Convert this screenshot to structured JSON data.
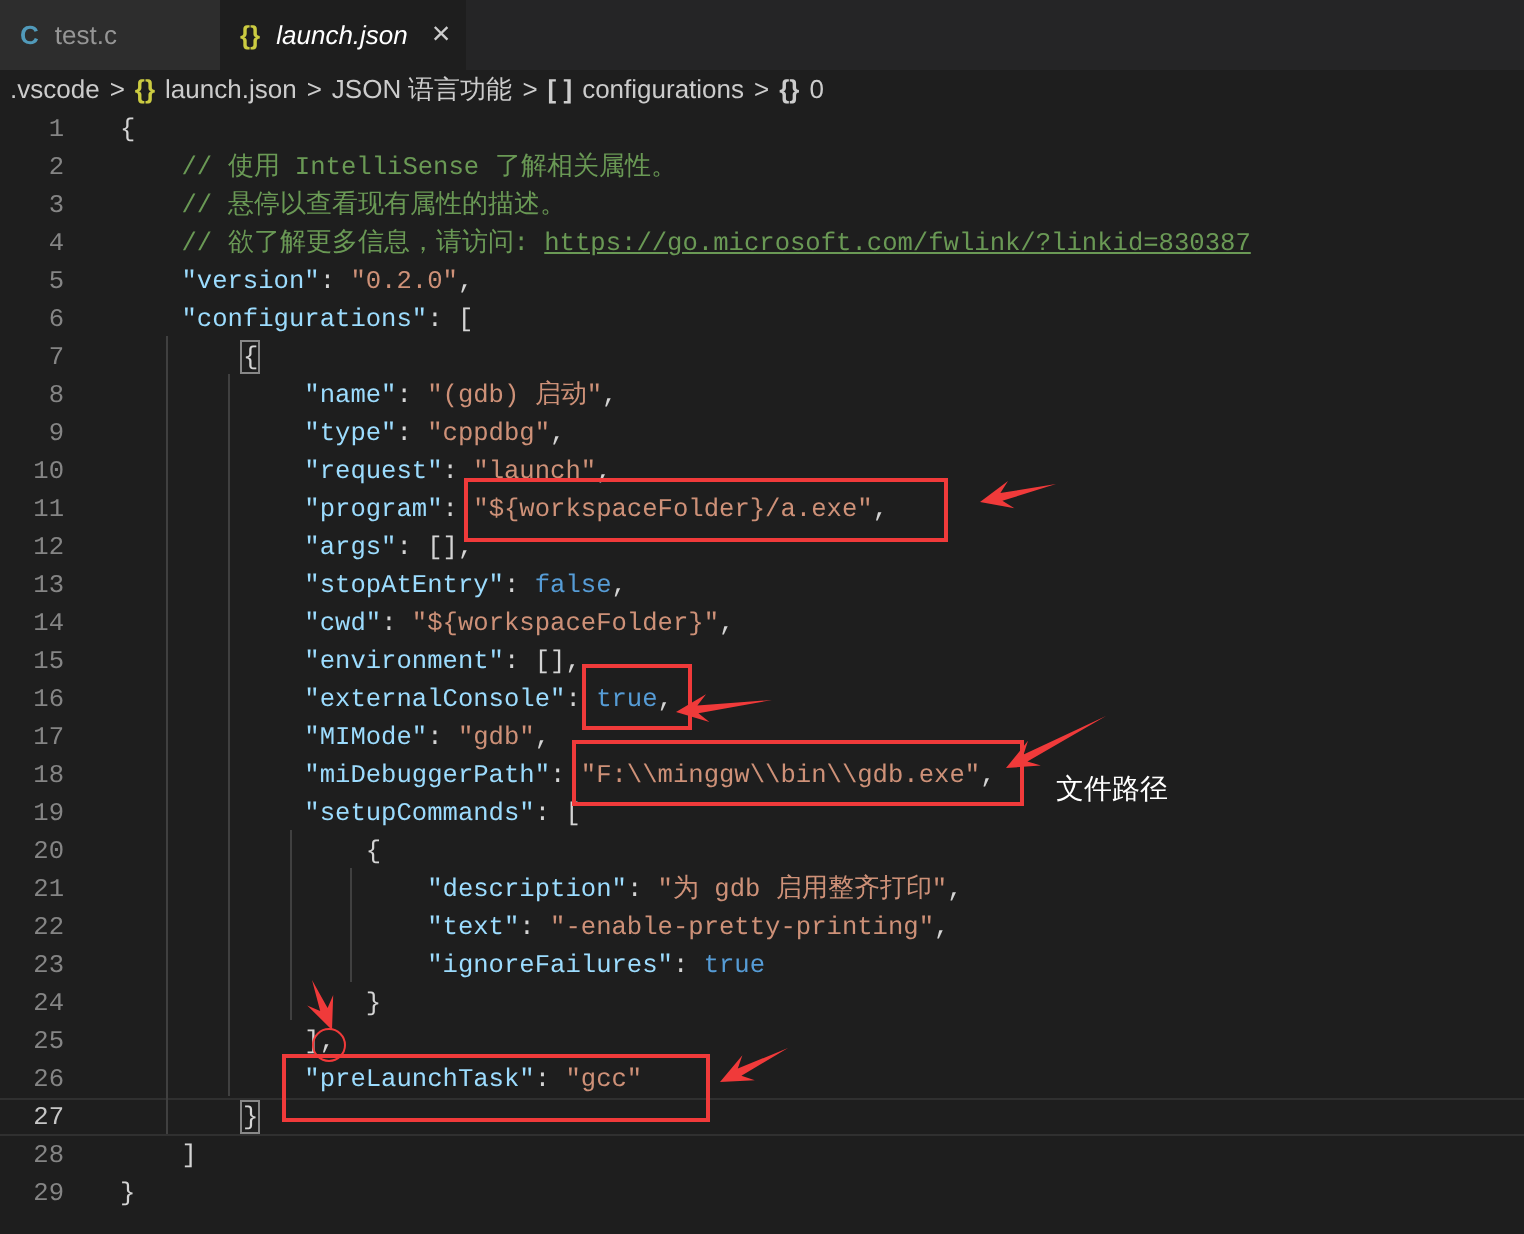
{
  "tabs": [
    {
      "icon": "C",
      "color": "#519aba",
      "label": "test.c",
      "selected": false,
      "preview": false
    },
    {
      "icon": "{}",
      "color": "#cbcb41",
      "label": "launch.json",
      "selected": true,
      "preview": true,
      "close": "×"
    }
  ],
  "breadcrumbs": [
    {
      "label": ".vscode"
    },
    {
      "separator": ">"
    },
    {
      "icon": "{}",
      "color": "#cbcb41",
      "label": "launch.json"
    },
    {
      "separator": ">"
    },
    {
      "label": "JSON 语言功能"
    },
    {
      "separator": ">"
    },
    {
      "icon": "[ ]",
      "color": "#cccccc",
      "label": "configurations"
    },
    {
      "separator": ">"
    },
    {
      "icon": "{}",
      "color": "#cccccc",
      "label": "0"
    }
  ],
  "editor": {
    "lines": [
      {
        "number": "1",
        "current": false,
        "tokens": [
          {
            "kind": "punct",
            "text": "{"
          }
        ]
      },
      {
        "number": "2",
        "current": false,
        "tokens": [
          {
            "kind": "comment",
            "text": "    // 使用 IntelliSense 了解相关属性。"
          }
        ]
      },
      {
        "number": "3",
        "current": false,
        "tokens": [
          {
            "kind": "comment",
            "text": "    // 悬停以查看现有属性的描述。"
          }
        ]
      },
      {
        "number": "4",
        "current": false,
        "tokens": [
          {
            "kind": "comment",
            "text": "    // 欲了解更多信息，请访问: "
          },
          {
            "kind": "link",
            "text": "https://go.microsoft.com/fwlink/?linkid=830387"
          }
        ]
      },
      {
        "number": "5",
        "current": false,
        "tokens": [
          {
            "kind": "key",
            "text": "    \"version\""
          },
          {
            "kind": "punct",
            "text": ": "
          },
          {
            "kind": "string",
            "text": "\"0.2.0\""
          },
          {
            "kind": "punct",
            "text": ","
          }
        ]
      },
      {
        "number": "6",
        "current": false,
        "tokens": [
          {
            "kind": "key",
            "text": "    \"configurations\""
          },
          {
            "kind": "punct",
            "text": ": ["
          }
        ]
      },
      {
        "number": "7",
        "current": false,
        "tokens": [
          {
            "kind": "punct",
            "text": "        {",
            "matched": true
          }
        ]
      },
      {
        "number": "8",
        "current": false,
        "tokens": [
          {
            "kind": "key",
            "text": "            \"name\""
          },
          {
            "kind": "punct",
            "text": ": "
          },
          {
            "kind": "string",
            "text": "\"(gdb) 启动\""
          },
          {
            "kind": "punct",
            "text": ","
          }
        ]
      },
      {
        "number": "9",
        "current": false,
        "tokens": [
          {
            "kind": "key",
            "text": "            \"type\""
          },
          {
            "kind": "punct",
            "text": ": "
          },
          {
            "kind": "string",
            "text": "\"cppdbg\""
          },
          {
            "kind": "punct",
            "text": ","
          }
        ]
      },
      {
        "number": "10",
        "current": false,
        "tokens": [
          {
            "kind": "key",
            "text": "            \"request\""
          },
          {
            "kind": "punct",
            "text": ": "
          },
          {
            "kind": "string",
            "text": "\"launch\""
          },
          {
            "kind": "punct",
            "text": ","
          }
        ]
      },
      {
        "number": "11",
        "current": false,
        "tokens": [
          {
            "kind": "key",
            "text": "            \"program\""
          },
          {
            "kind": "punct",
            "text": ": "
          },
          {
            "kind": "string",
            "text": "\"${workspaceFolder}/a.exe\""
          },
          {
            "kind": "punct",
            "text": ","
          }
        ]
      },
      {
        "number": "12",
        "current": false,
        "tokens": [
          {
            "kind": "key",
            "text": "            \"args\""
          },
          {
            "kind": "punct",
            "text": ": [],"
          }
        ]
      },
      {
        "number": "13",
        "current": false,
        "tokens": [
          {
            "kind": "key",
            "text": "            \"stopAtEntry\""
          },
          {
            "kind": "punct",
            "text": ": "
          },
          {
            "kind": "keyword",
            "text": "false"
          },
          {
            "kind": "punct",
            "text": ","
          }
        ]
      },
      {
        "number": "14",
        "current": false,
        "tokens": [
          {
            "kind": "key",
            "text": "            \"cwd\""
          },
          {
            "kind": "punct",
            "text": ": "
          },
          {
            "kind": "string",
            "text": "\"${workspaceFolder}\""
          },
          {
            "kind": "punct",
            "text": ","
          }
        ]
      },
      {
        "number": "15",
        "current": false,
        "tokens": [
          {
            "kind": "key",
            "text": "            \"environment\""
          },
          {
            "kind": "punct",
            "text": ": [],"
          }
        ]
      },
      {
        "number": "16",
        "current": false,
        "tokens": [
          {
            "kind": "key",
            "text": "            \"externalConsole\""
          },
          {
            "kind": "punct",
            "text": ": "
          },
          {
            "kind": "keyword",
            "text": "true"
          },
          {
            "kind": "punct",
            "text": ","
          }
        ]
      },
      {
        "number": "17",
        "current": false,
        "tokens": [
          {
            "kind": "key",
            "text": "            \"MIMode\""
          },
          {
            "kind": "punct",
            "text": ": "
          },
          {
            "kind": "string",
            "text": "\"gdb\""
          },
          {
            "kind": "punct",
            "text": ","
          }
        ]
      },
      {
        "number": "18",
        "current": false,
        "tokens": [
          {
            "kind": "key",
            "text": "            \"miDebuggerPath\""
          },
          {
            "kind": "punct",
            "text": ": "
          },
          {
            "kind": "string",
            "text": "\"F:\\\\minggw\\\\bin\\\\gdb.exe\""
          },
          {
            "kind": "punct",
            "text": ","
          }
        ]
      },
      {
        "number": "19",
        "current": false,
        "tokens": [
          {
            "kind": "key",
            "text": "            \"setupCommands\""
          },
          {
            "kind": "punct",
            "text": ": ["
          }
        ]
      },
      {
        "number": "20",
        "current": false,
        "tokens": [
          {
            "kind": "punct",
            "text": "                {"
          }
        ]
      },
      {
        "number": "21",
        "current": false,
        "tokens": [
          {
            "kind": "key",
            "text": "                    \"description\""
          },
          {
            "kind": "punct",
            "text": ": "
          },
          {
            "kind": "string",
            "text": "\"为 gdb 启用整齐打印\""
          },
          {
            "kind": "punct",
            "text": ","
          }
        ]
      },
      {
        "number": "22",
        "current": false,
        "tokens": [
          {
            "kind": "key",
            "text": "                    \"text\""
          },
          {
            "kind": "punct",
            "text": ": "
          },
          {
            "kind": "string",
            "text": "\"-enable-pretty-printing\""
          },
          {
            "kind": "punct",
            "text": ","
          }
        ]
      },
      {
        "number": "23",
        "current": false,
        "tokens": [
          {
            "kind": "key",
            "text": "                    \"ignoreFailures\""
          },
          {
            "kind": "punct",
            "text": ": "
          },
          {
            "kind": "keyword",
            "text": "true"
          }
        ]
      },
      {
        "number": "24",
        "current": false,
        "tokens": [
          {
            "kind": "punct",
            "text": "                }"
          }
        ]
      },
      {
        "number": "25",
        "current": false,
        "tokens": [
          {
            "kind": "punct",
            "text": "            ]"
          },
          {
            "kind": "punct",
            "text": ","
          }
        ]
      },
      {
        "number": "26",
        "current": false,
        "tokens": [
          {
            "kind": "key",
            "text": "            \"preLaunchTask\""
          },
          {
            "kind": "punct",
            "text": ": "
          },
          {
            "kind": "string",
            "text": "\"gcc\""
          }
        ]
      },
      {
        "number": "27",
        "current": true,
        "tokens": [
          {
            "kind": "punct",
            "text": "        }",
            "matched": true
          }
        ]
      },
      {
        "number": "28",
        "current": false,
        "tokens": [
          {
            "kind": "punct",
            "text": "    ]"
          }
        ]
      },
      {
        "number": "29",
        "current": false,
        "tokens": [
          {
            "kind": "punct",
            "text": "}"
          }
        ]
      }
    ]
  },
  "annotation_label": "文件路径"
}
